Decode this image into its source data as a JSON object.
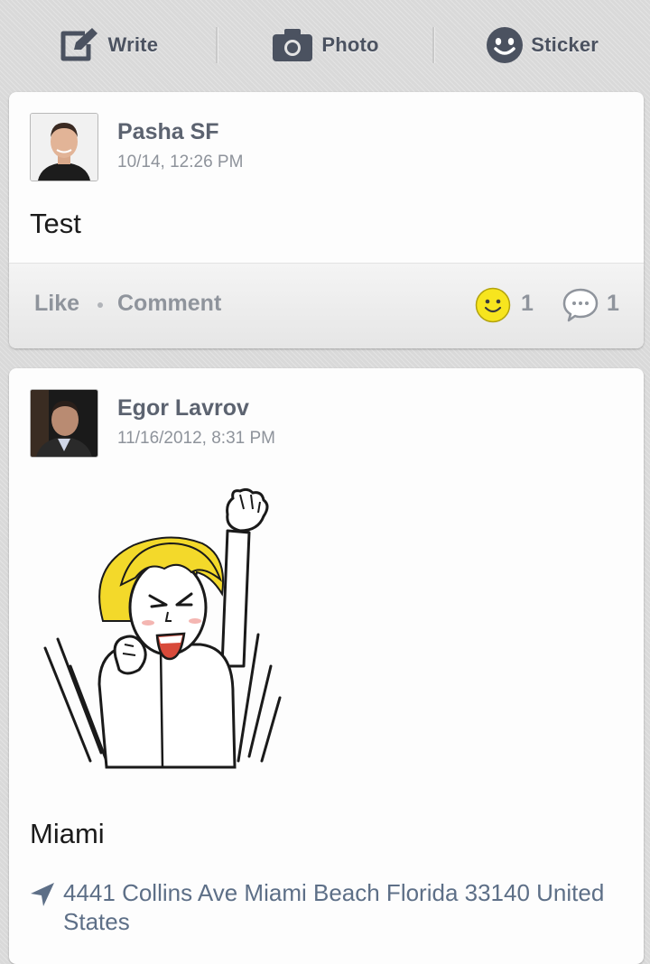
{
  "toolbar": {
    "write_label": "Write",
    "photo_label": "Photo",
    "sticker_label": "Sticker"
  },
  "posts": [
    {
      "author": "Pasha SF",
      "timestamp": "10/14, 12:26 PM",
      "text": "Test",
      "like_label": "Like",
      "comment_label": "Comment",
      "reaction_count": "1",
      "comment_count": "1"
    },
    {
      "author": "Egor Lavrov",
      "timestamp": "11/16/2012, 8:31 PM",
      "text": "Miami",
      "location": "4441 Collins Ave Miami Beach Florida 33140 United States"
    }
  ],
  "icons": {
    "toolbar": [
      "write-icon",
      "camera-icon",
      "sticker-icon"
    ],
    "post_actions": [
      "smiley-reaction-icon",
      "comment-bubble-icon"
    ],
    "location": "location-arrow-icon"
  },
  "colors": {
    "page_background": "#d9d9d9",
    "card_background": "#fdfdfd",
    "toolbar_text": "#4b5260",
    "author_text": "#5c6370",
    "muted_text": "#8f949c",
    "location_text": "#5d6f87",
    "reaction_yellow": "#f7e51e"
  }
}
